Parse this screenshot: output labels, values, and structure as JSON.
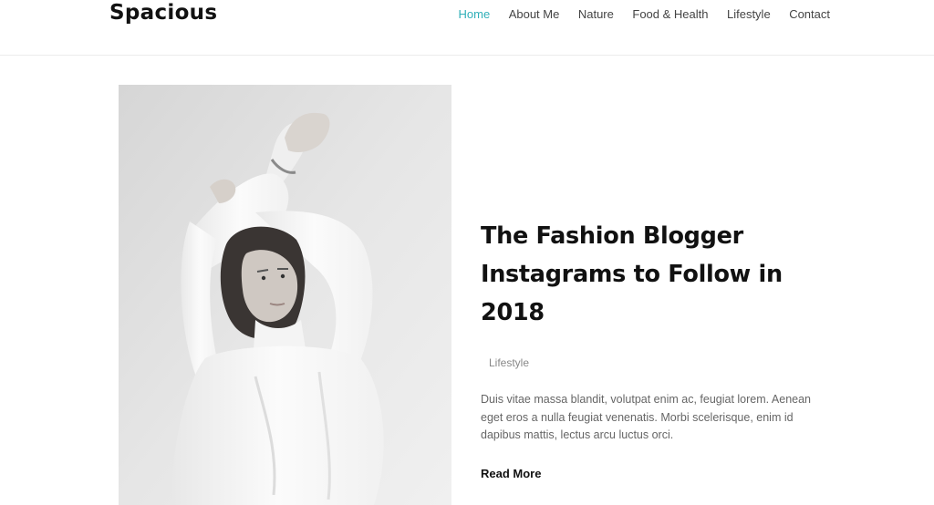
{
  "site": {
    "title": "Spacious"
  },
  "nav": {
    "items": [
      {
        "label": "Home",
        "active": true
      },
      {
        "label": "About Me",
        "active": false
      },
      {
        "label": "Nature",
        "active": false
      },
      {
        "label": "Food & Health",
        "active": false
      },
      {
        "label": "Lifestyle",
        "active": false
      },
      {
        "label": "Contact",
        "active": false
      }
    ]
  },
  "post": {
    "title": "The Fashion Blogger Instagrams to Follow in 2018",
    "category": "Lifestyle",
    "excerpt": "Duis vitae massa blandit, volutpat enim ac, feugiat lorem. Aenean eget eros a nulla feugiat venenatis. Morbi scelerisque, enim id dapibus mattis, lectus arcu luctus orci.",
    "read_more_label": "Read More",
    "image_description_icon": "photo-woman-white-sweater"
  },
  "colors": {
    "accent": "#30afb8",
    "text": "#111111",
    "muted": "#888888",
    "nav_text": "#444444"
  }
}
